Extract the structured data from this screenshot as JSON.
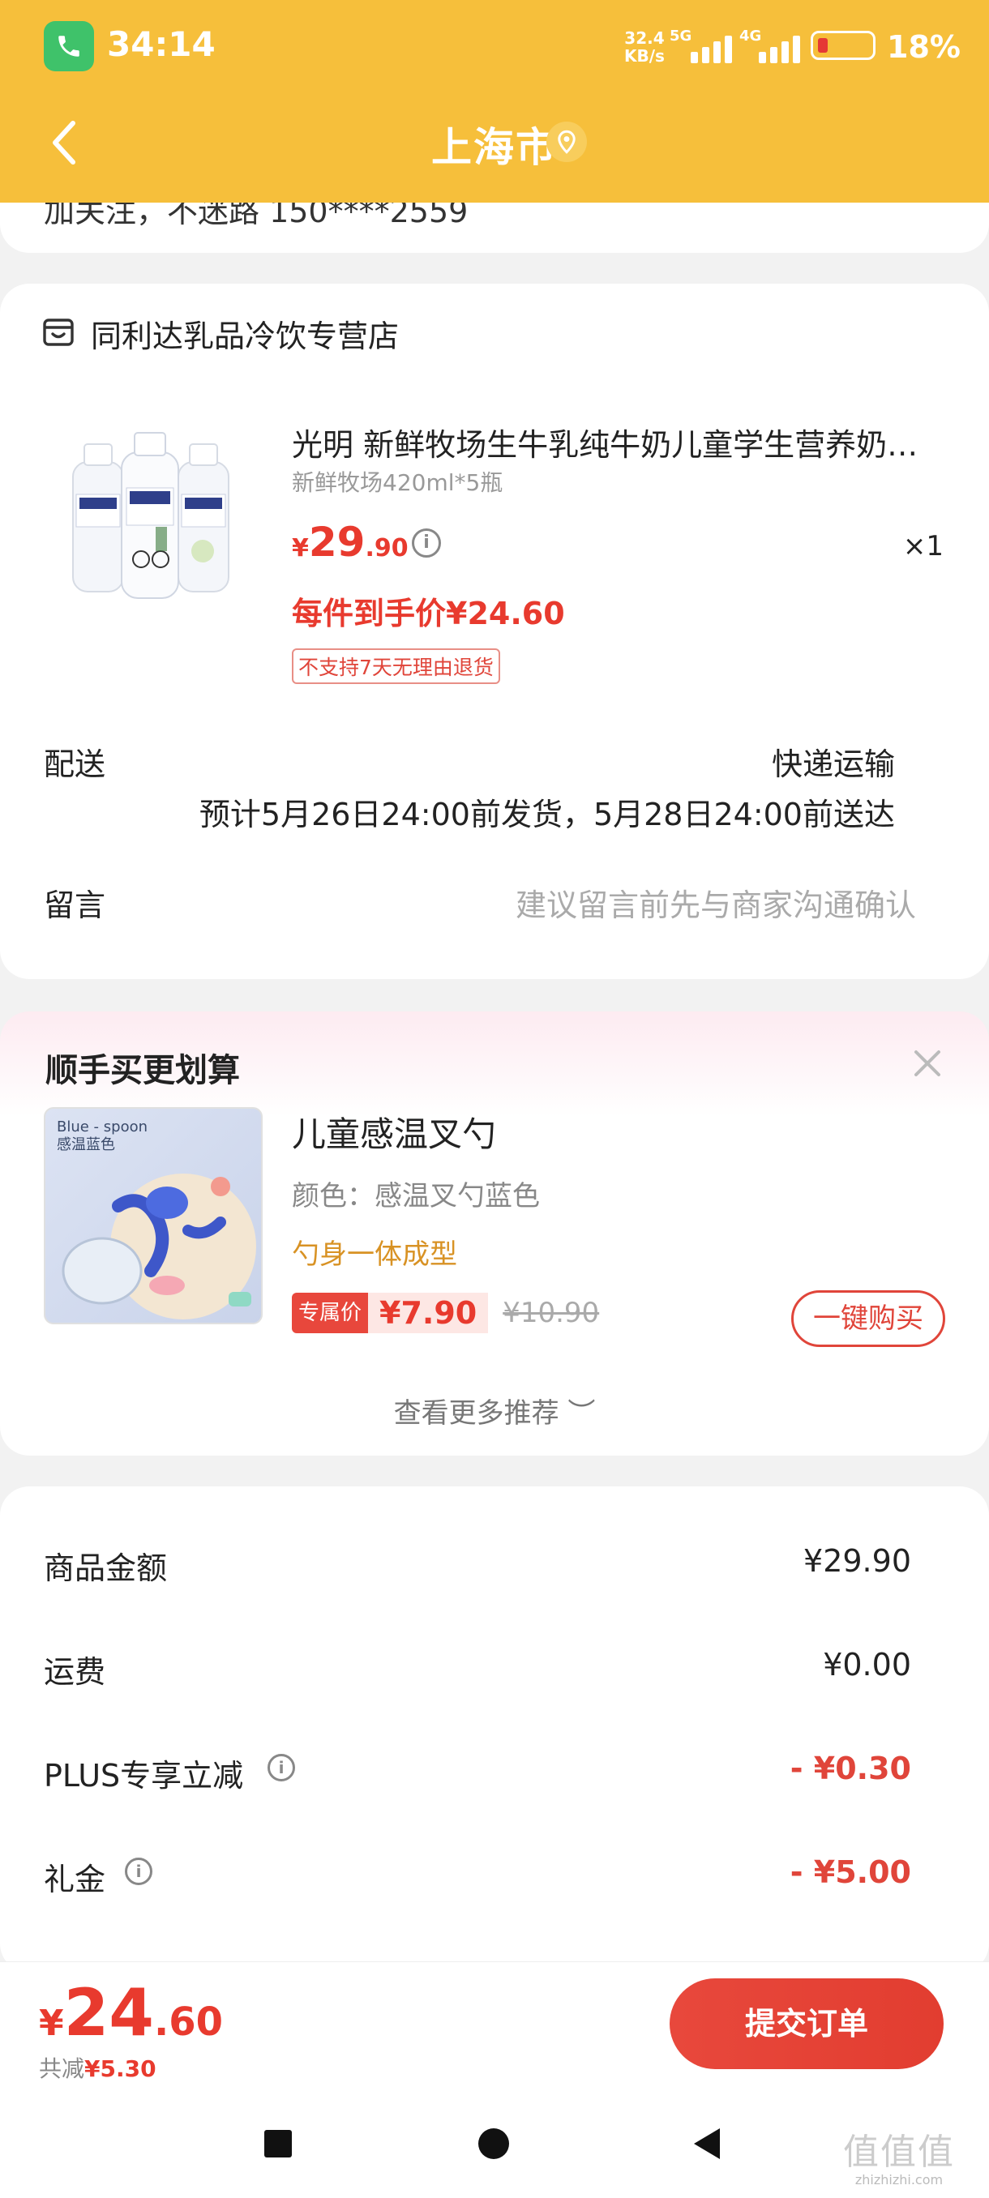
{
  "status_bar": {
    "time": "34:14",
    "net_speed": "32.4",
    "net_unit": "KB/s",
    "sig1": "5G",
    "sig2": "4G",
    "battery": "18%",
    "battery_level": 0.18
  },
  "nav": {
    "title": "上海市"
  },
  "address": {
    "line": "加关注，不迷路 150****2559"
  },
  "shop": {
    "name": "同利达乳品冷饮专营店"
  },
  "product": {
    "title": "光明 新鲜牧场生牛乳纯牛奶儿童学生营养奶…",
    "spec": "新鲜牧场420ml*5瓶",
    "price_yen": "¥",
    "price_int": "29",
    "price_dec": ".90",
    "qty": "×1",
    "deal_price": "每件到手价¥24.60",
    "no_return": "不支持7天无理由退货",
    "info_icon": "i"
  },
  "shipping": {
    "label": "配送",
    "type": "快递运输",
    "eta": "预计5月26日24:00前发货，5月28日24:00前送达"
  },
  "message": {
    "label": "留言",
    "placeholder": "建议留言前先与商家沟通确认"
  },
  "recommend": {
    "title": "顺手买更划算",
    "image_tag_line1": "Blue - spoon",
    "image_tag_line2": "感温蓝色",
    "name": "儿童感温叉勺",
    "color": "颜色：感温叉勺蓝色",
    "feature": "勺身一体成型",
    "badge": "专属价",
    "price": "¥7.90",
    "orig_price": "¥10.90",
    "buy_label": "一键购买",
    "more": "查看更多推荐 ︶"
  },
  "summary": {
    "rows": [
      {
        "label": "商品金额",
        "value": "¥29.90"
      },
      {
        "label": "运费",
        "value": "¥0.00"
      },
      {
        "label": "PLUS专享立减",
        "value": "- ¥0.30"
      },
      {
        "label": "礼金",
        "value": "- ¥5.00"
      }
    ],
    "info_icon": "i"
  },
  "bottom": {
    "total_yen": "¥",
    "total_int": "24",
    "total_dec": ".60",
    "saved_label": "共减",
    "saved_amount": "¥5.30",
    "submit": "提交订单"
  },
  "watermark": {
    "big": "值值值",
    "small": "zhizhizhi.com"
  },
  "colors": {
    "header": "#f6bf3b",
    "accent_red": "#e83a2e",
    "feature_gold": "#d89224"
  }
}
